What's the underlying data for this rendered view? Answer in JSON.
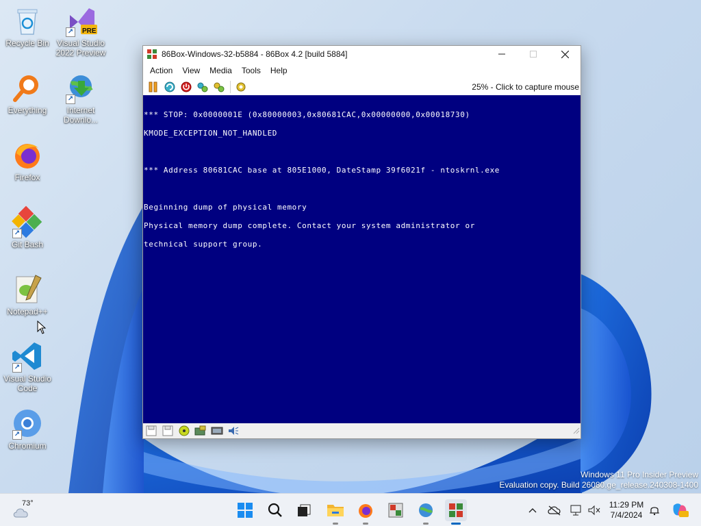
{
  "desktop": {
    "icons": [
      {
        "label": "Recycle Bin"
      },
      {
        "label": "Visual Studio 2022 Preview",
        "badge": "PRE"
      },
      {
        "label": "Everything"
      },
      {
        "label": "Internet Downlo..."
      },
      {
        "label": "Firefox"
      },
      {
        "label": "Git Bash"
      },
      {
        "label": "Notepad++"
      },
      {
        "label": "Visual Studio Code"
      },
      {
        "label": "Chromium"
      }
    ]
  },
  "window": {
    "title": "86Box-Windows-32-b5884 - 86Box 4.2 [build 5884]",
    "menu": [
      "Action",
      "View",
      "Media",
      "Tools",
      "Help"
    ],
    "toolbar_status": "25% - Click to capture mouse",
    "screen_lines": [
      "*** STOP: 0x0000001E (0x80000003,0x80681CAC,0x00000000,0x00018730)",
      "KMODE_EXCEPTION_NOT_HANDLED",
      "",
      "*** Address 80681CAC base at 805E1000, DateStamp 39f6021f - ntoskrnl.exe",
      "",
      "Beginning dump of physical memory",
      "Physical memory dump complete. Contact your system administrator or",
      "technical support group."
    ]
  },
  "watermark": {
    "line1": "Windows 11 Pro Insider Preview",
    "line2": "Evaluation copy. Build 26080.ge_release.240308-1400"
  },
  "taskbar": {
    "weather_temp": "73°",
    "clock_time": "11:29 PM",
    "clock_date": "7/4/2024"
  },
  "colors": {
    "bsod_blue": "#000080",
    "accent": "#0067c0"
  }
}
